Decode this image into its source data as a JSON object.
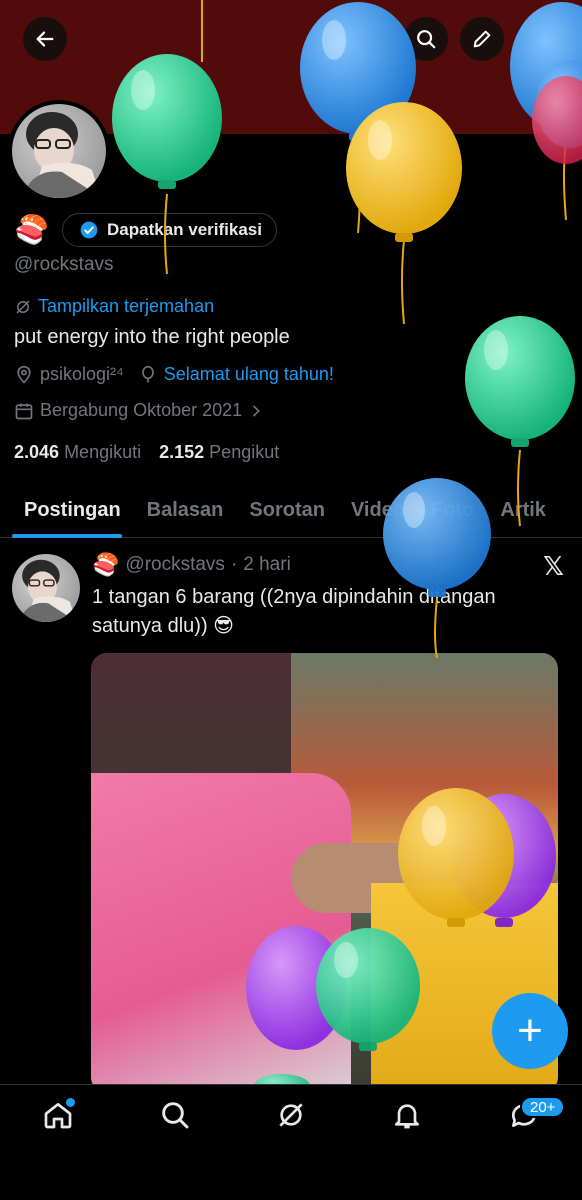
{
  "profile": {
    "emoji": "🍣",
    "verify_label": "Dapatkan verifikasi",
    "handle": "@rockstavs",
    "translate_label": "Tampilkan terjemahan",
    "bio": "put energy into the right people",
    "location": "psikologi²⁴",
    "birthday_label": "Selamat ulang tahun!",
    "joined": "Bergabung Oktober 2021",
    "following_count": "2.046",
    "following_label": "Mengikuti",
    "followers_count": "2.152",
    "followers_label": "Pengikut"
  },
  "tabs": [
    "Postingan",
    "Balasan",
    "Sorotan",
    "Video",
    "Foto",
    "Artik"
  ],
  "post": {
    "emoji": "🍣",
    "handle": "@rockstavs",
    "separator": "·",
    "time": "2 hari",
    "text": "1 tangan 6 barang ((2nya dipindahin ditangan satunya dlu)) 😎",
    "platform_logo": "𝕏"
  },
  "fab_label": "+",
  "nav": {
    "notifications_badge": "20+"
  },
  "icons": {
    "back": "back-arrow-icon",
    "grok": "grok-icon",
    "search": "search-icon",
    "edit": "pencil-icon",
    "share": "share-icon"
  },
  "colors": {
    "accent": "#1d9bf0",
    "background": "#000000",
    "banner": "#520b0b",
    "muted_text": "#71767b"
  }
}
